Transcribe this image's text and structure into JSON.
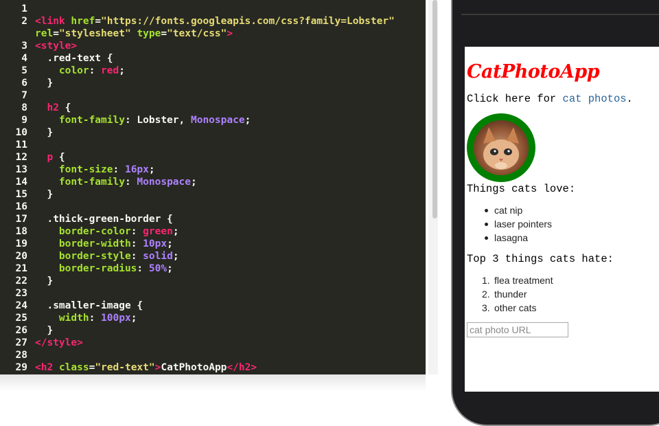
{
  "editor": {
    "lines": [
      {
        "n": "1",
        "tokens": []
      },
      {
        "n": "2",
        "tokens": [
          [
            "t-tag",
            "<link"
          ],
          [
            "t-plain",
            " "
          ],
          [
            "t-attr",
            "href"
          ],
          [
            "t-plain",
            "="
          ],
          [
            "t-str",
            "\"https://fonts.googleapis.com/css?family=Lobster\""
          ]
        ]
      },
      {
        "n": "",
        "tokens": [
          [
            "t-attr",
            "rel"
          ],
          [
            "t-plain",
            "="
          ],
          [
            "t-str",
            "\"stylesheet\""
          ],
          [
            "t-plain",
            " "
          ],
          [
            "t-attr",
            "type"
          ],
          [
            "t-plain",
            "="
          ],
          [
            "t-str",
            "\"text/css\""
          ],
          [
            "t-tag",
            ">"
          ]
        ]
      },
      {
        "n": "3",
        "tokens": [
          [
            "t-tag",
            "<style>"
          ]
        ]
      },
      {
        "n": "4",
        "tokens": [
          [
            "t-plain",
            "  .red-text {"
          ]
        ]
      },
      {
        "n": "5",
        "tokens": [
          [
            "t-plain",
            "    "
          ],
          [
            "t-prop",
            "color"
          ],
          [
            "t-plain",
            ": "
          ],
          [
            "t-kw",
            "red"
          ],
          [
            "t-plain",
            ";"
          ]
        ]
      },
      {
        "n": "6",
        "tokens": [
          [
            "t-plain",
            "  }"
          ]
        ]
      },
      {
        "n": "7",
        "tokens": []
      },
      {
        "n": "8",
        "tokens": [
          [
            "t-plain",
            "  "
          ],
          [
            "t-kw",
            "h2"
          ],
          [
            "t-plain",
            " {"
          ]
        ]
      },
      {
        "n": "9",
        "tokens": [
          [
            "t-plain",
            "    "
          ],
          [
            "t-prop",
            "font-family"
          ],
          [
            "t-plain",
            ": Lobster, "
          ],
          [
            "t-num",
            "Monospace"
          ],
          [
            "t-plain",
            ";"
          ]
        ]
      },
      {
        "n": "10",
        "tokens": [
          [
            "t-plain",
            "  }"
          ]
        ]
      },
      {
        "n": "11",
        "tokens": []
      },
      {
        "n": "12",
        "tokens": [
          [
            "t-plain",
            "  "
          ],
          [
            "t-kw",
            "p"
          ],
          [
            "t-plain",
            " {"
          ]
        ]
      },
      {
        "n": "13",
        "tokens": [
          [
            "t-plain",
            "    "
          ],
          [
            "t-prop",
            "font-size"
          ],
          [
            "t-plain",
            ": "
          ],
          [
            "t-num",
            "16px"
          ],
          [
            "t-plain",
            ";"
          ]
        ]
      },
      {
        "n": "14",
        "tokens": [
          [
            "t-plain",
            "    "
          ],
          [
            "t-prop",
            "font-family"
          ],
          [
            "t-plain",
            ": "
          ],
          [
            "t-num",
            "Monospace"
          ],
          [
            "t-plain",
            ";"
          ]
        ]
      },
      {
        "n": "15",
        "tokens": [
          [
            "t-plain",
            "  }"
          ]
        ]
      },
      {
        "n": "16",
        "tokens": []
      },
      {
        "n": "17",
        "tokens": [
          [
            "t-plain",
            "  .thick-green-border {"
          ]
        ]
      },
      {
        "n": "18",
        "tokens": [
          [
            "t-plain",
            "    "
          ],
          [
            "t-prop",
            "border-color"
          ],
          [
            "t-plain",
            ": "
          ],
          [
            "t-kw",
            "green"
          ],
          [
            "t-plain",
            ";"
          ]
        ]
      },
      {
        "n": "19",
        "tokens": [
          [
            "t-plain",
            "    "
          ],
          [
            "t-prop",
            "border-width"
          ],
          [
            "t-plain",
            ": "
          ],
          [
            "t-num",
            "10px"
          ],
          [
            "t-plain",
            ";"
          ]
        ]
      },
      {
        "n": "20",
        "tokens": [
          [
            "t-plain",
            "    "
          ],
          [
            "t-prop",
            "border-style"
          ],
          [
            "t-plain",
            ": "
          ],
          [
            "t-num",
            "solid"
          ],
          [
            "t-plain",
            ";"
          ]
        ]
      },
      {
        "n": "21",
        "tokens": [
          [
            "t-plain",
            "    "
          ],
          [
            "t-prop",
            "border-radius"
          ],
          [
            "t-plain",
            ": "
          ],
          [
            "t-num",
            "50%"
          ],
          [
            "t-plain",
            ";"
          ]
        ]
      },
      {
        "n": "22",
        "tokens": [
          [
            "t-plain",
            "  }"
          ]
        ]
      },
      {
        "n": "23",
        "tokens": []
      },
      {
        "n": "24",
        "tokens": [
          [
            "t-plain",
            "  .smaller-image {"
          ]
        ]
      },
      {
        "n": "25",
        "tokens": [
          [
            "t-plain",
            "    "
          ],
          [
            "t-prop",
            "width"
          ],
          [
            "t-plain",
            ": "
          ],
          [
            "t-num",
            "100px"
          ],
          [
            "t-plain",
            ";"
          ]
        ]
      },
      {
        "n": "26",
        "tokens": [
          [
            "t-plain",
            "  }"
          ]
        ]
      },
      {
        "n": "27",
        "tokens": [
          [
            "t-tag",
            "</style>"
          ]
        ]
      },
      {
        "n": "28",
        "tokens": []
      },
      {
        "n": "29",
        "tokens": [
          [
            "t-tag",
            "<h2"
          ],
          [
            "t-plain",
            " "
          ],
          [
            "t-attr",
            "class"
          ],
          [
            "t-plain",
            "="
          ],
          [
            "t-str",
            "\"red-text\""
          ],
          [
            "t-tag",
            ">"
          ],
          [
            "t-plain",
            "CatPhotoApp"
          ],
          [
            "t-tag",
            "</h2>"
          ]
        ]
      }
    ]
  },
  "preview": {
    "title": "CatPhotoApp",
    "intro_text": "Click here for ",
    "intro_link": "cat photos",
    "intro_end": ".",
    "love_heading": "Things cats love:",
    "love_items": [
      "cat nip",
      "laser pointers",
      "lasagna"
    ],
    "hate_heading": "Top 3 things cats hate:",
    "hate_items": [
      "flea treatment",
      "thunder",
      "other cats"
    ],
    "input_placeholder": "cat photo URL",
    "colors": {
      "title": "#ff0000",
      "border": "#008000",
      "link": "#2a6496"
    }
  }
}
